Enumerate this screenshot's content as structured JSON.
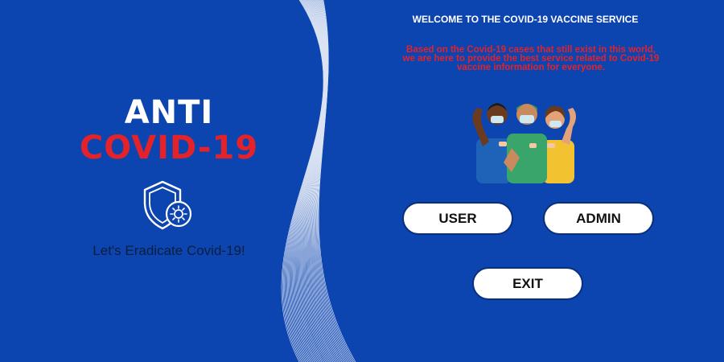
{
  "brand": {
    "line1": "ANTI",
    "line2": "COVID-19",
    "tagline": "Let's Eradicate Covid-19!",
    "shield_icon": "shield-virus-icon"
  },
  "welcome": {
    "title": "WELCOME TO THE COVID-19 VACCINE SERVICE",
    "description": "Based on the Covid-19 cases that still exist in this world, we are here to provide the best service related to Covid-19 vaccine information for everyone."
  },
  "illustration": "vaccinated-people-illustration",
  "buttons": {
    "user": "USER",
    "admin": "ADMIN",
    "exit": "EXIT"
  },
  "colors": {
    "background": "#0d45b0",
    "accent_red": "#e3222a",
    "white": "#ffffff"
  }
}
